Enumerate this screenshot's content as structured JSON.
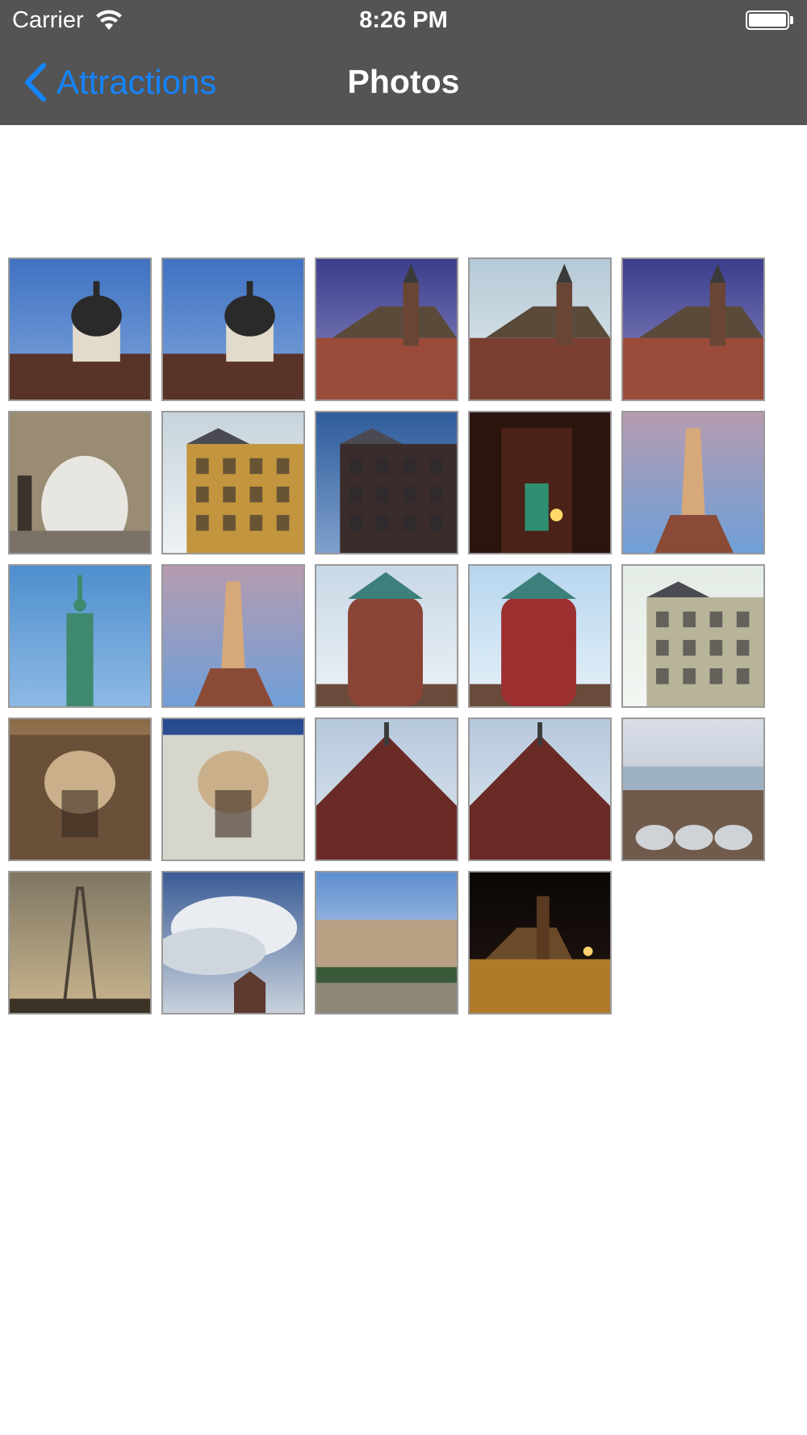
{
  "status_bar": {
    "carrier": "Carrier",
    "time": "8:26 PM",
    "wifi_icon": "wifi-icon",
    "battery_icon": "battery-icon"
  },
  "nav": {
    "back_label": "Attractions",
    "back_icon": "chevron-left-icon",
    "title": "Photos",
    "accent_color": "#1584ff",
    "bar_color": "#545454"
  },
  "photos": [
    {
      "subject": "dome tower"
    },
    {
      "subject": "dome tower"
    },
    {
      "subject": "brick cathedral"
    },
    {
      "subject": "cathedral square"
    },
    {
      "subject": "brick cathedral"
    },
    {
      "subject": "stone archway"
    },
    {
      "subject": "yellow art nouveau building"
    },
    {
      "subject": "dark corner building"
    },
    {
      "subject": "night street"
    },
    {
      "subject": "obelisk monument"
    },
    {
      "subject": "freedom monument"
    },
    {
      "subject": "obelisk monument"
    },
    {
      "subject": "round brick tower"
    },
    {
      "subject": "red ivy tower"
    },
    {
      "subject": "three brothers houses"
    },
    {
      "subject": "ornate facade"
    },
    {
      "subject": "art nouveau facade"
    },
    {
      "subject": "house of blackheads"
    },
    {
      "subject": "house of blackheads"
    },
    {
      "subject": "city panorama"
    },
    {
      "subject": "tv tower"
    },
    {
      "subject": "clouds over tower"
    },
    {
      "subject": "town square"
    },
    {
      "subject": "cathedral at night"
    }
  ]
}
